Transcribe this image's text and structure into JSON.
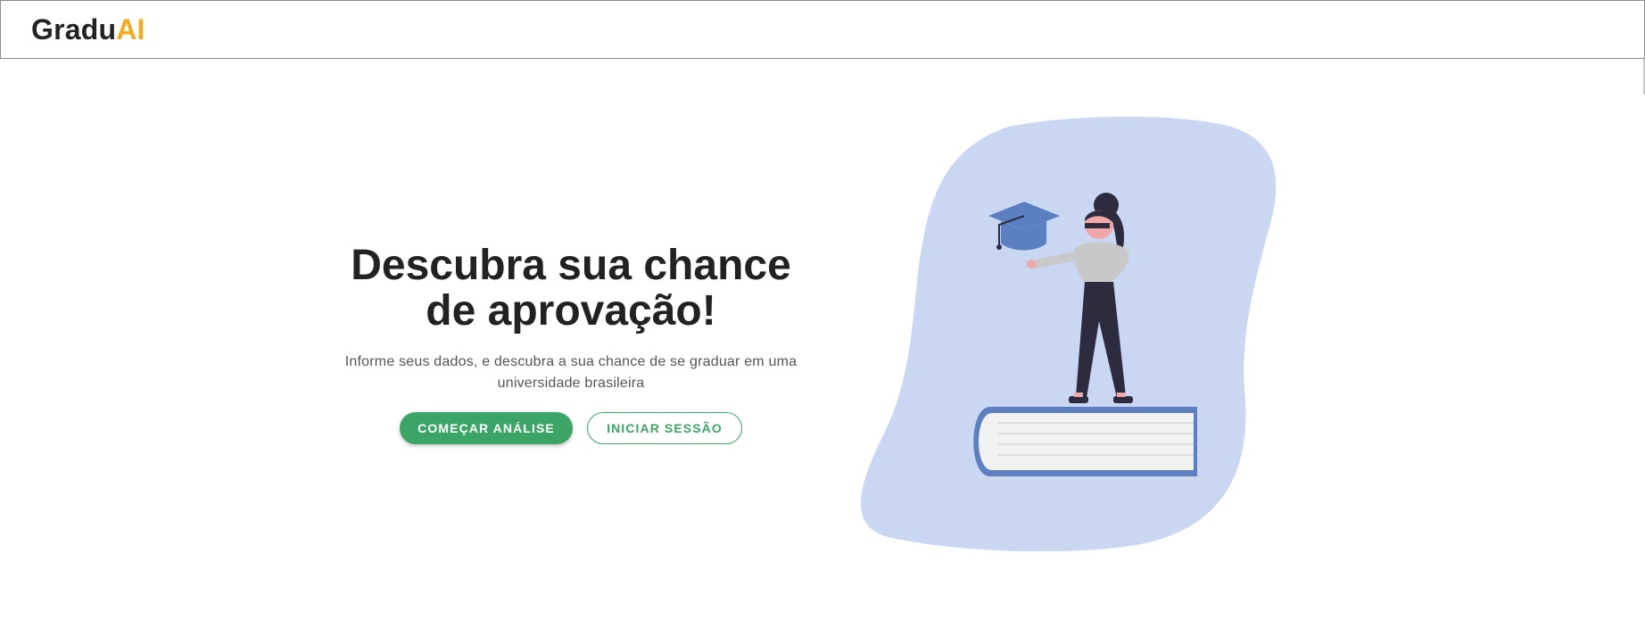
{
  "header": {
    "logo_part1": "Gradu",
    "logo_part2": "AI"
  },
  "hero": {
    "title": "Descubra sua chance de aprovação!",
    "subtitle": "Informe seus dados, e descubra a sua chance de se graduar em uma universidade brasileira",
    "primary_button": "COMEÇAR ANÁLISE",
    "secondary_button": "INICIAR SESSÃO"
  },
  "illustration": {
    "icon": "graduation-illustration",
    "colors": {
      "blob": "#c9d7f3",
      "cap": "#5b7fc0",
      "book": "#5b7fc0",
      "figure_pants": "#2d2c3e",
      "figure_top": "#c8c8c8"
    }
  },
  "colors": {
    "accent_green": "#3aa565",
    "logo_orange": "#f4ab1e",
    "text_dark": "#222222"
  }
}
